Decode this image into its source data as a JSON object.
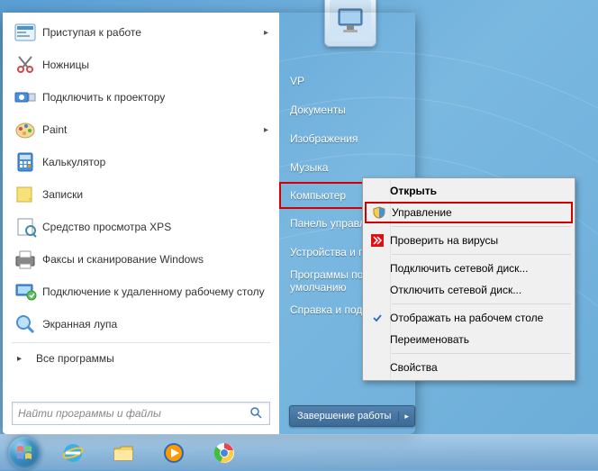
{
  "avatar": {},
  "apps": [
    {
      "label": "Приступая к работе",
      "arrow": true,
      "icon": "getting-started"
    },
    {
      "label": "Ножницы",
      "arrow": false,
      "icon": "snipping-tool"
    },
    {
      "label": "Подключить к проектору",
      "arrow": false,
      "icon": "projector"
    },
    {
      "label": "Paint",
      "arrow": true,
      "icon": "paint"
    },
    {
      "label": "Калькулятор",
      "arrow": false,
      "icon": "calculator"
    },
    {
      "label": "Записки",
      "arrow": false,
      "icon": "sticky-notes"
    },
    {
      "label": "Средство просмотра XPS",
      "arrow": false,
      "icon": "xps-viewer"
    },
    {
      "label": "Факсы и сканирование Windows",
      "arrow": false,
      "icon": "fax-scan"
    },
    {
      "label": "Подключение к удаленному рабочему столу",
      "arrow": false,
      "icon": "remote-desktop"
    },
    {
      "label": "Экранная лупа",
      "arrow": false,
      "icon": "magnifier"
    }
  ],
  "all_programs": "Все программы",
  "search": {
    "placeholder": "Найти программы и файлы"
  },
  "right_items": [
    {
      "label": "VP",
      "hl": false
    },
    {
      "label": "Документы",
      "hl": false
    },
    {
      "label": "Изображения",
      "hl": false
    },
    {
      "label": "Музыка",
      "hl": false
    },
    {
      "label": "Компьютер",
      "hl": true
    },
    {
      "label": "Панель управления",
      "hl": false
    },
    {
      "label": "Устройства и принтеры",
      "hl": false
    },
    {
      "label": "Программы по умолчанию",
      "hl": false
    },
    {
      "label": "Справка и поддержка",
      "hl": false
    }
  ],
  "shutdown": {
    "label": "Завершение работы",
    "arrow": "▸"
  },
  "context": {
    "open": "Открыть",
    "manage": "Управление",
    "scan": "Проверить на вирусы",
    "map": "Подключить сетевой диск...",
    "unmap": "Отключить сетевой диск...",
    "show_desktop": "Отображать на рабочем столе",
    "rename": "Переименовать",
    "properties": "Свойства"
  },
  "taskbar": {
    "items": [
      "ie",
      "explorer",
      "media-player",
      "chrome"
    ]
  }
}
